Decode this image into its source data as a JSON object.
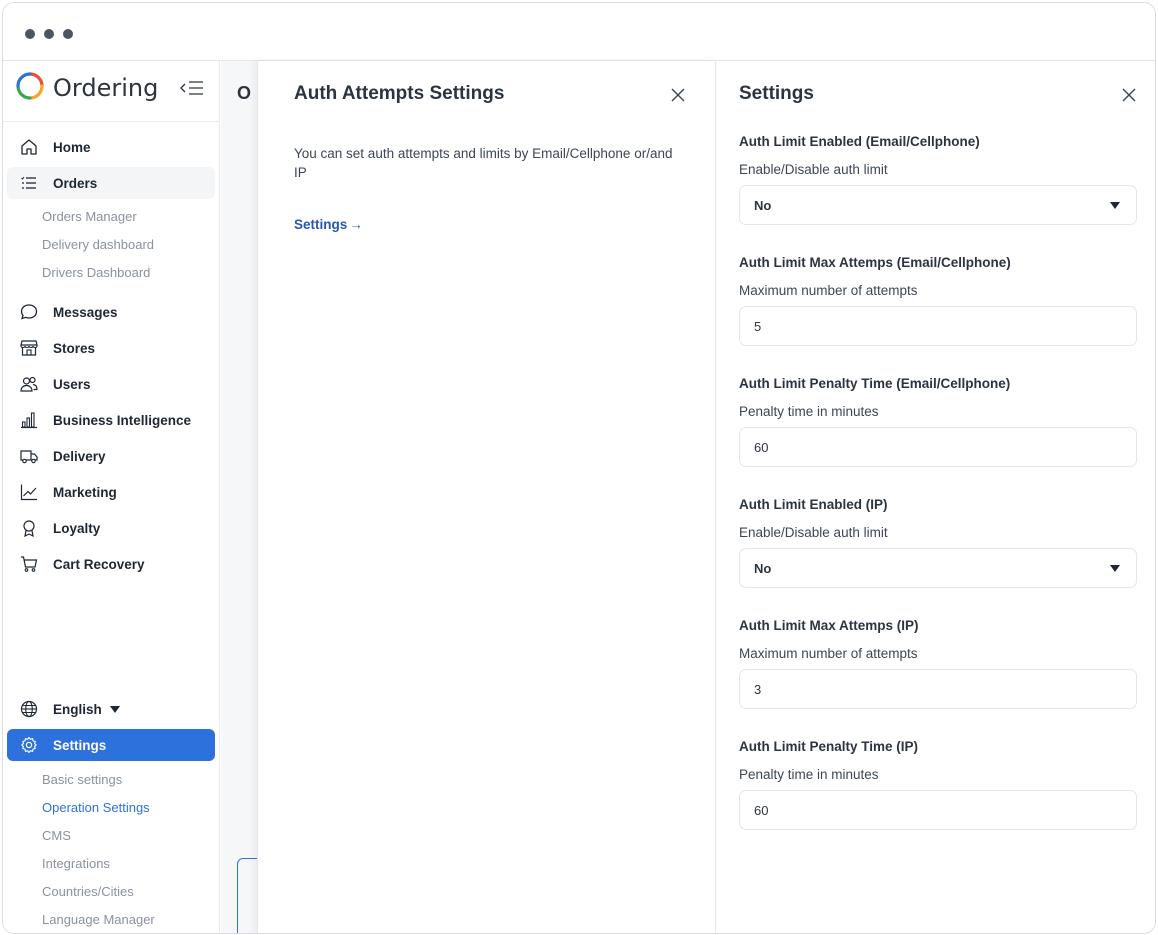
{
  "window": {
    "controls": [
      "dot",
      "dot",
      "dot"
    ]
  },
  "sidebar": {
    "brand": "Ordering",
    "collapse_icon": "collapse-sidebar-icon",
    "items": [
      {
        "label": "Home",
        "icon": "home-icon"
      },
      {
        "label": "Orders",
        "icon": "orders-list-icon"
      },
      {
        "label": "Messages",
        "icon": "chat-bubble-icon"
      },
      {
        "label": "Stores",
        "icon": "store-icon"
      },
      {
        "label": "Users",
        "icon": "users-icon"
      },
      {
        "label": "Business Intelligence",
        "icon": "bar-chart-icon"
      },
      {
        "label": "Delivery",
        "icon": "truck-icon"
      },
      {
        "label": "Marketing",
        "icon": "line-chart-icon"
      },
      {
        "label": "Loyalty",
        "icon": "badge-icon"
      },
      {
        "label": "Cart Recovery",
        "icon": "cart-icon"
      }
    ],
    "orders_subitems": [
      "Orders Manager",
      "Delivery dashboard",
      "Drivers Dashboard"
    ],
    "language": {
      "label": "English",
      "icon": "globe-icon"
    },
    "settings": {
      "label": "Settings",
      "icon": "gear-icon"
    },
    "settings_subitems": [
      "Basic settings",
      "Operation Settings",
      "CMS",
      "Integrations",
      "Countries/Cities",
      "Language Manager"
    ],
    "colors": {
      "accent": "#2d72dc",
      "logo": [
        "#e94b3c",
        "#f5a623",
        "#3aa655",
        "#2d72dc"
      ]
    }
  },
  "background_page": {
    "title_fragment": "O"
  },
  "auth_panel": {
    "title": "Auth Attempts Settings",
    "description": "You can set auth attempts and limits by Email/Cellphone or/and IP",
    "link": "Settings",
    "link_arrow": "→"
  },
  "settings_panel": {
    "title": "Settings",
    "fields": [
      {
        "title": "Auth Limit Enabled (Email/Cellphone)",
        "subtitle": "Enable/Disable auth limit",
        "value": "No",
        "type": "select"
      },
      {
        "title": "Auth Limit Max Attemps (Email/Cellphone)",
        "subtitle": "Maximum number of attempts",
        "value": "5",
        "type": "input"
      },
      {
        "title": "Auth Limit Penalty Time (Email/Cellphone)",
        "subtitle": "Penalty time in minutes",
        "value": "60",
        "type": "input"
      },
      {
        "title": "Auth Limit Enabled (IP)",
        "subtitle": "Enable/Disable auth limit",
        "value": "No",
        "type": "select"
      },
      {
        "title": "Auth Limit Max Attemps (IP)",
        "subtitle": "Maximum number of attempts",
        "value": "3",
        "type": "input"
      },
      {
        "title": "Auth Limit Penalty Time (IP)",
        "subtitle": "Penalty time in minutes",
        "value": "60",
        "type": "input"
      }
    ]
  }
}
